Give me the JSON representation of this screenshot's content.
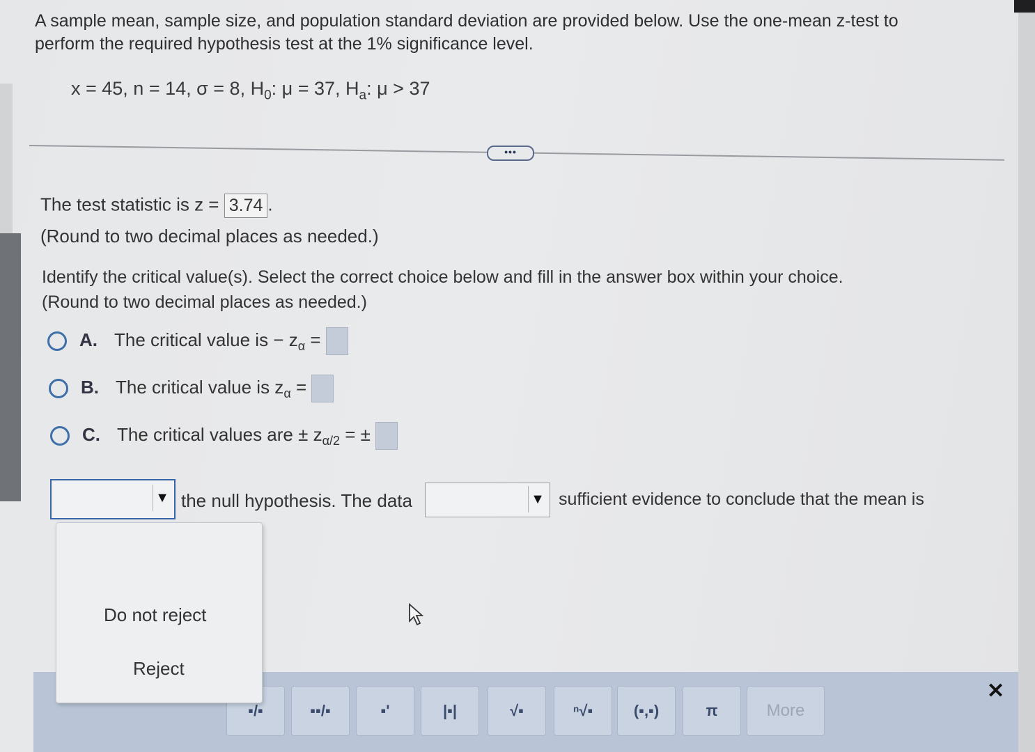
{
  "problem": {
    "statement": "A sample mean, sample size, and population standard deviation are provided below. Use the one-mean z-test to perform the required hypothesis test at the 1% significance level.",
    "given_pre": "x = 45, n = 14, σ = 8, H",
    "given_h0_sub": "0",
    "given_mid": ": μ = 37, H",
    "given_ha_sub": "a",
    "given_post": ": μ > 37"
  },
  "more_label": "•••",
  "test_statistic": {
    "label": "The test statistic is z =",
    "value": "3.74",
    "round_note": "(Round to two decimal places as needed.)"
  },
  "critical": {
    "instruction": "Identify the critical value(s). Select the correct choice below and fill in the answer box within your choice.",
    "round_note": "(Round to two decimal places as needed.)",
    "options": [
      {
        "letter": "A.",
        "text": "The critical value is  − z",
        "sub": "α",
        "suffix": " ="
      },
      {
        "letter": "B.",
        "text": "The critical value is z",
        "sub": "α",
        "suffix": " ="
      },
      {
        "letter": "C.",
        "text": "The critical values are  ± z",
        "sub": "α/2",
        "suffix": " = ±"
      }
    ]
  },
  "conclusion": {
    "select1_value": "",
    "text1": "the null hypothesis. The data",
    "select2_value": "",
    "text2": "sufficient evidence to conclude  that the mean is"
  },
  "dropdown": {
    "options": [
      "Do not reject",
      "Reject"
    ]
  },
  "toolbar": {
    "buttons": [
      {
        "icon": "fraction-icon",
        "glyph": "▪/▪"
      },
      {
        "icon": "mixed-number-icon",
        "glyph": "▪▪/▪"
      },
      {
        "icon": "exponent-icon",
        "glyph": "▪'"
      },
      {
        "icon": "absolute-value-icon",
        "glyph": "|▪|"
      },
      {
        "icon": "square-root-icon",
        "glyph": "√▪"
      },
      {
        "icon": "nth-root-icon",
        "glyph": "ⁿ√▪"
      },
      {
        "icon": "ordered-pair-icon",
        "glyph": "(▪,▪)"
      },
      {
        "icon": "pi-icon",
        "glyph": "π"
      }
    ],
    "more_label": "More",
    "close_glyph": "✕"
  }
}
